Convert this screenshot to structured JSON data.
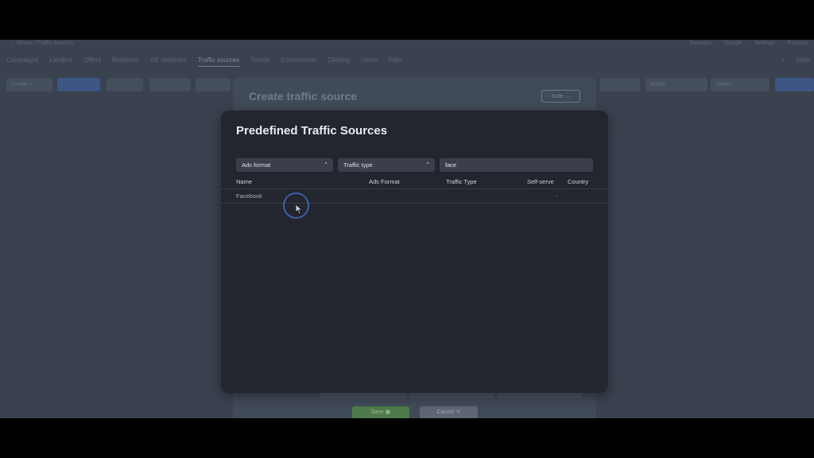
{
  "app": {
    "breadcrumb": "← Binom / Traffic sources",
    "top_links": [
      "Domains",
      "Google",
      "Settings",
      "Payouts"
    ],
    "nav_tabs": [
      "Campaigns",
      "Landers",
      "Offers",
      "Rotations",
      "Aff. networks",
      "Traffic sources",
      "Trends",
      "Conversions",
      "Clicklog",
      "Users",
      "Files"
    ],
    "nav_active": "Traffic sources",
    "nav_right": [
      "Help"
    ],
    "toolbar_buttons": [
      "Create +",
      "",
      "",
      "",
      ""
    ],
    "toolbar_right": [
      "Active",
      "Select"
    ]
  },
  "create_panel": {
    "title": "Create traffic source",
    "note_button": "Note →",
    "save_button": "Save",
    "cancel_button": "Cancel"
  },
  "modal": {
    "title": "Predefined Traffic Sources",
    "filters": {
      "ads_format": "Ads format",
      "traffic_type": "Traffic type",
      "search_value": "face"
    },
    "columns": [
      "Name",
      "Ads Format",
      "Traffic Type",
      "Self-serve",
      "Country"
    ],
    "rows": [
      {
        "name": "Facebook",
        "ads_format": "",
        "traffic_type": "",
        "self_serve": "-",
        "country": ""
      }
    ]
  },
  "colors": {
    "modal_bg": "#23252f",
    "overlay_bg": "#3a4250",
    "cursor_ring": "#3c5fa8"
  },
  "icons": [
    "chevron-up-icon",
    "note-arrow-icon",
    "save-icon",
    "close-icon",
    "mouse-pointer-icon"
  ]
}
